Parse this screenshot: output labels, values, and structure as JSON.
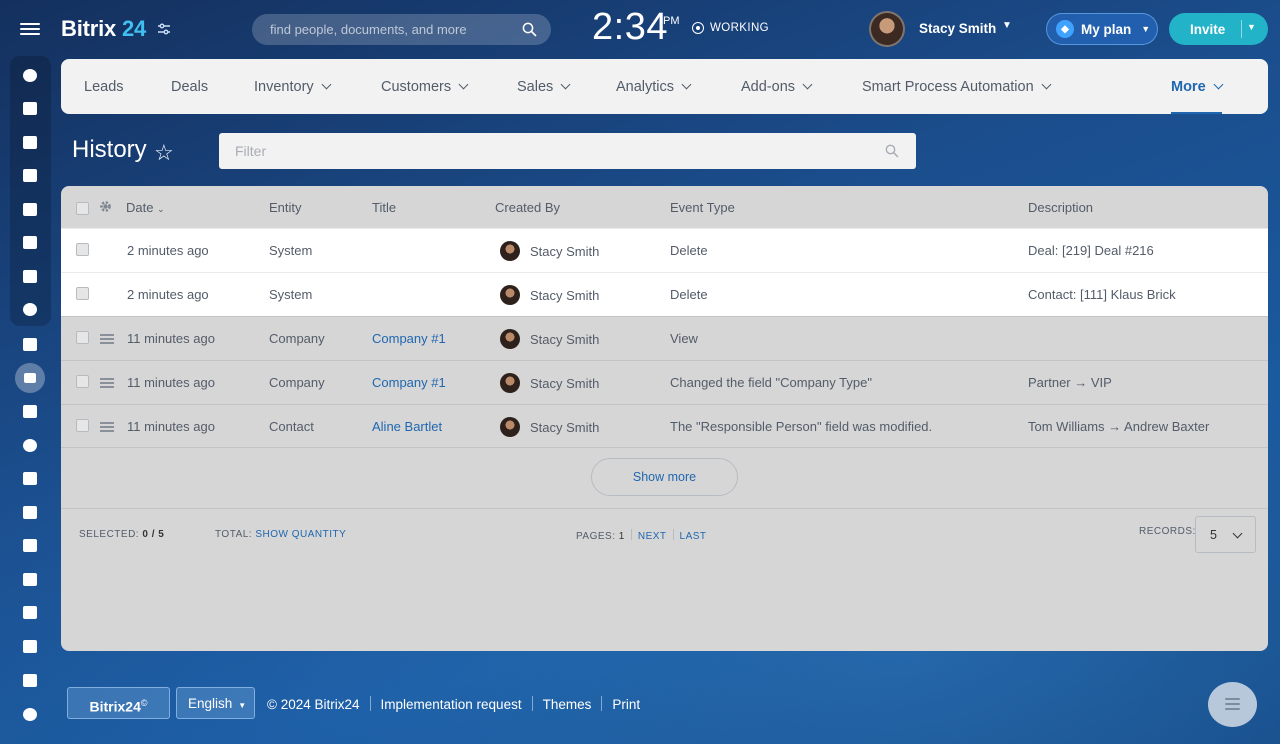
{
  "app": {
    "logo_text": "Bitrix",
    "logo_num": "24"
  },
  "search": {
    "placeholder": "find people, documents, and more"
  },
  "clock": {
    "time": "2:34",
    "ampm": "PM",
    "status": "WORKING"
  },
  "user": {
    "name": "Stacy Smith"
  },
  "plan": {
    "label": "My plan"
  },
  "invite": {
    "label": "Invite"
  },
  "nav": {
    "items": [
      "Leads",
      "Deals",
      "Inventory",
      "Customers",
      "Sales",
      "Analytics",
      "Add-ons",
      "Smart Process Automation"
    ],
    "more": "More"
  },
  "page": {
    "title": "History"
  },
  "filter": {
    "placeholder": "Filter"
  },
  "grid": {
    "columns": {
      "date": "Date",
      "entity": "Entity",
      "title": "Title",
      "created_by": "Created By",
      "event_type": "Event Type",
      "description": "Description"
    },
    "rows": [
      {
        "date": "2 minutes ago",
        "entity": "System",
        "title": "",
        "created_by": "Stacy Smith",
        "event_type": "Delete",
        "description": "Deal: [219] Deal #216"
      },
      {
        "date": "2 minutes ago",
        "entity": "System",
        "title": "",
        "created_by": "Stacy Smith",
        "event_type": "Delete",
        "description": "Contact: [111] Klaus Brick"
      },
      {
        "date": "11 minutes ago",
        "entity": "Company",
        "title": "Company #1",
        "created_by": "Stacy Smith",
        "event_type": "View",
        "description": ""
      },
      {
        "date": "11 minutes ago",
        "entity": "Company",
        "title": "Company #1",
        "created_by": "Stacy Smith",
        "event_type": "Changed the field \"Company Type\"",
        "description": "Partner → VIP"
      },
      {
        "date": "11 minutes ago",
        "entity": "Contact",
        "title": "Aline Bartlet",
        "created_by": "Stacy Smith",
        "event_type": "The \"Responsible Person\" field was modified.",
        "description": "Tom Williams → Andrew Baxter"
      }
    ],
    "show_more": "Show more",
    "footer": {
      "selected_label": "SELECTED:",
      "selected_value": "0 / 5",
      "total_label": "TOTAL:",
      "total_link": "SHOW QUANTITY",
      "pages_label": "PAGES:",
      "page_num": "1",
      "next": "NEXT",
      "last": "LAST",
      "records_label": "RECORDS:",
      "records_value": "5"
    }
  },
  "bottom": {
    "brand": "Bitrix24",
    "lang": "English",
    "copyright": "© 2024 Bitrix24",
    "links": [
      "Implementation request",
      "Themes",
      "Print"
    ]
  }
}
